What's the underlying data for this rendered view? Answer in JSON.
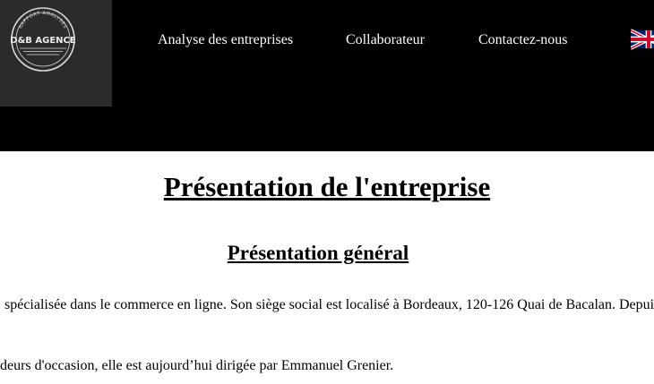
{
  "logo": {
    "name": "D&B AGENCE",
    "tagline": "RAPPORT ANALYSES"
  },
  "nav": {
    "items": [
      {
        "label": "Analyse des entreprises"
      },
      {
        "label": "Collaborateur"
      },
      {
        "label": "Contactez-nous"
      }
    ],
    "language_icon": "uk-flag-icon"
  },
  "main": {
    "title": "Présentation de l'entreprise",
    "subtitle": "Présentation général",
    "paragraphs": [
      "spécialisée dans le commerce en ligne. Son siège social est localisé à Bordeaux, 120-126 Quai de Bacalan. Depuis",
      "deurs d'occasion, elle est aujourd’hui dirigée par Emmanuel Grenier."
    ]
  },
  "colors": {
    "header_bg": "#000000",
    "logo_bg": "#2b2b2d",
    "nav_text": "#ffffff",
    "body_text": "#000000"
  }
}
